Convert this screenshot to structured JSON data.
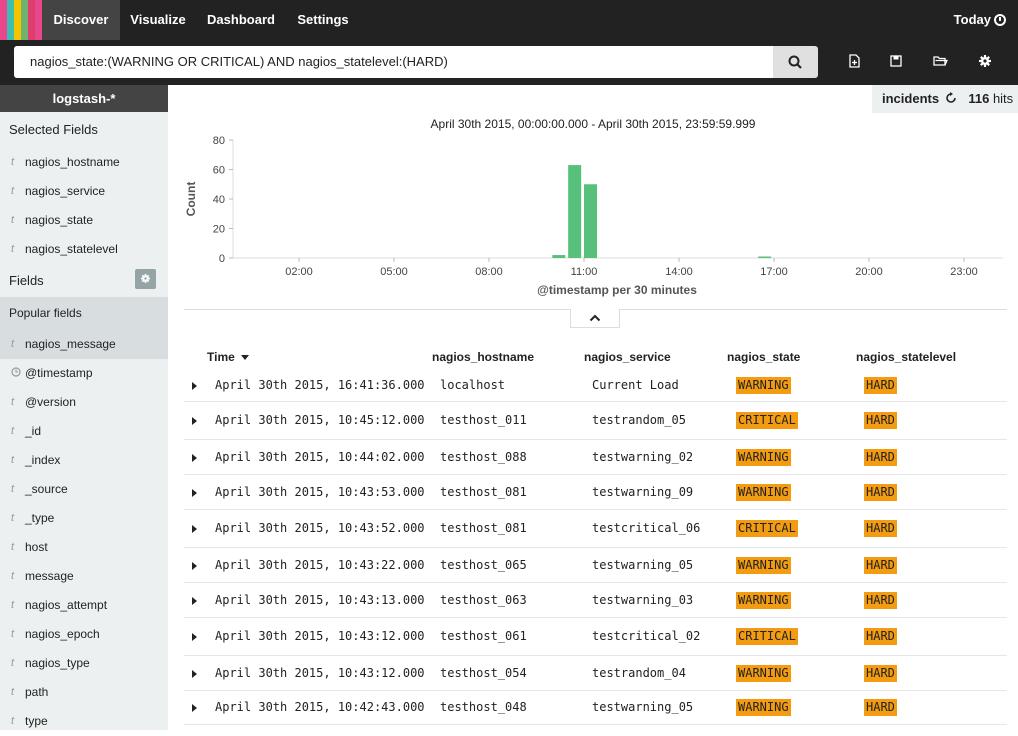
{
  "nav": {
    "tabs": [
      "Discover",
      "Visualize",
      "Dashboard",
      "Settings"
    ],
    "time_label": "Today"
  },
  "search": {
    "query": "nagios_state:(WARNING OR CRITICAL) AND nagios_statelevel:(HARD)"
  },
  "sidebar": {
    "index_pattern": "logstash-*",
    "selected_title": "Selected Fields",
    "selected_fields": [
      "nagios_hostname",
      "nagios_service",
      "nagios_state",
      "nagios_statelevel"
    ],
    "fields_title": "Fields",
    "popular_title": "Popular fields",
    "popular_fields": [
      "nagios_message"
    ],
    "fields": [
      "@timestamp",
      "@version",
      "_id",
      "_index",
      "_source",
      "_type",
      "host",
      "message",
      "nagios_attempt",
      "nagios_epoch",
      "nagios_type",
      "path",
      "type"
    ]
  },
  "hits": {
    "search_name": "incidents",
    "count": "116",
    "label": "hits"
  },
  "chart_data": {
    "type": "bar",
    "title": "April 30th 2015, 00:00:00.000 - April 30th 2015, 23:59:59.999",
    "xlabel": "@timestamp per 30 minutes",
    "ylabel": "Count",
    "ylim": [
      0,
      80
    ],
    "yticks": [
      0,
      20,
      40,
      60,
      80
    ],
    "xticks": [
      "02:00",
      "05:00",
      "08:00",
      "11:00",
      "14:00",
      "17:00",
      "20:00",
      "23:00"
    ],
    "x": [
      "10:00",
      "10:30",
      "11:00",
      "16:30"
    ],
    "values": [
      2,
      63,
      50,
      1
    ],
    "color": "#57c17b"
  },
  "table": {
    "columns": [
      "Time",
      "nagios_hostname",
      "nagios_service",
      "nagios_state",
      "nagios_statelevel"
    ],
    "rows": [
      [
        "April 30th 2015, 16:41:36.000",
        "localhost",
        "Current Load",
        "WARNING",
        "HARD"
      ],
      [
        "April 30th 2015, 10:45:12.000",
        "testhost_011",
        "testrandom_05",
        "CRITICAL",
        "HARD"
      ],
      [
        "April 30th 2015, 10:44:02.000",
        "testhost_088",
        "testwarning_02",
        "WARNING",
        "HARD"
      ],
      [
        "April 30th 2015, 10:43:53.000",
        "testhost_081",
        "testwarning_09",
        "WARNING",
        "HARD"
      ],
      [
        "April 30th 2015, 10:43:52.000",
        "testhost_081",
        "testcritical_06",
        "CRITICAL",
        "HARD"
      ],
      [
        "April 30th 2015, 10:43:22.000",
        "testhost_065",
        "testwarning_05",
        "WARNING",
        "HARD"
      ],
      [
        "April 30th 2015, 10:43:13.000",
        "testhost_063",
        "testwarning_03",
        "WARNING",
        "HARD"
      ],
      [
        "April 30th 2015, 10:43:12.000",
        "testhost_061",
        "testcritical_02",
        "CRITICAL",
        "HARD"
      ],
      [
        "April 30th 2015, 10:43:12.000",
        "testhost_054",
        "testrandom_04",
        "WARNING",
        "HARD"
      ],
      [
        "April 30th 2015, 10:42:43.000",
        "testhost_048",
        "testwarning_05",
        "WARNING",
        "HARD"
      ]
    ]
  },
  "colors": {
    "accent_bar": "#57c17b",
    "badge": "#f39c12",
    "nav_bg": "#222222",
    "sidebar_bg": "#ecf0f1"
  }
}
